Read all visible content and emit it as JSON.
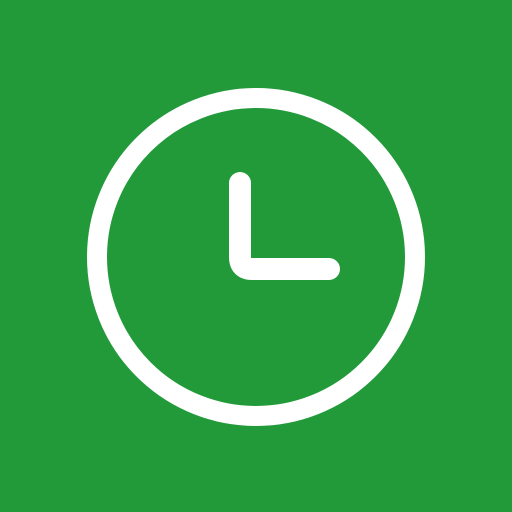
{
  "app_tile": {
    "icon": "clock-icon",
    "background_color": "#229A3A",
    "icon_color": "#FFFFFF"
  }
}
